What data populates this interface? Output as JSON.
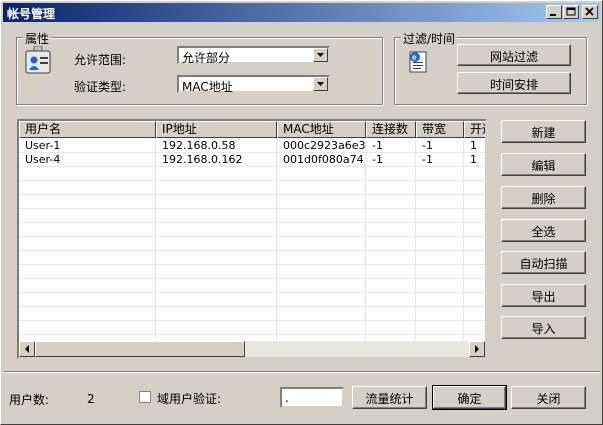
{
  "window": {
    "title": "帐号管理"
  },
  "attributes": {
    "legend": "属性",
    "scope_label": "允许范围:",
    "scope_value": "允许部分",
    "auth_label": "验证类型:",
    "auth_value": "MAC地址"
  },
  "filter": {
    "legend": "过滤/时间",
    "site_filter_label": "网站过滤",
    "schedule_label": "时间安排"
  },
  "table": {
    "columns": [
      "用户名",
      "IP地址",
      "MAC地址",
      "连接数",
      "带宽",
      "开通"
    ],
    "rows": [
      [
        "User-1",
        "192.168.0.58",
        "000c2923a6e3",
        "-1",
        "-1",
        "1"
      ],
      [
        "User-4",
        "192.168.0.162",
        "001d0f080a74",
        "-1",
        "-1",
        "1"
      ]
    ]
  },
  "side_buttons": {
    "new": "新建",
    "edit": "编辑",
    "delete": "删除",
    "select_all": "全选",
    "auto_scan": "自动扫描",
    "export": "导出",
    "import": "导入"
  },
  "footer": {
    "user_count_label": "用户数:",
    "user_count": "2",
    "domain_auth_label": "域用户验证:",
    "domain_value": ".",
    "traffic_label": "流量统计",
    "ok_label": "确定",
    "close_label": "关闭"
  }
}
